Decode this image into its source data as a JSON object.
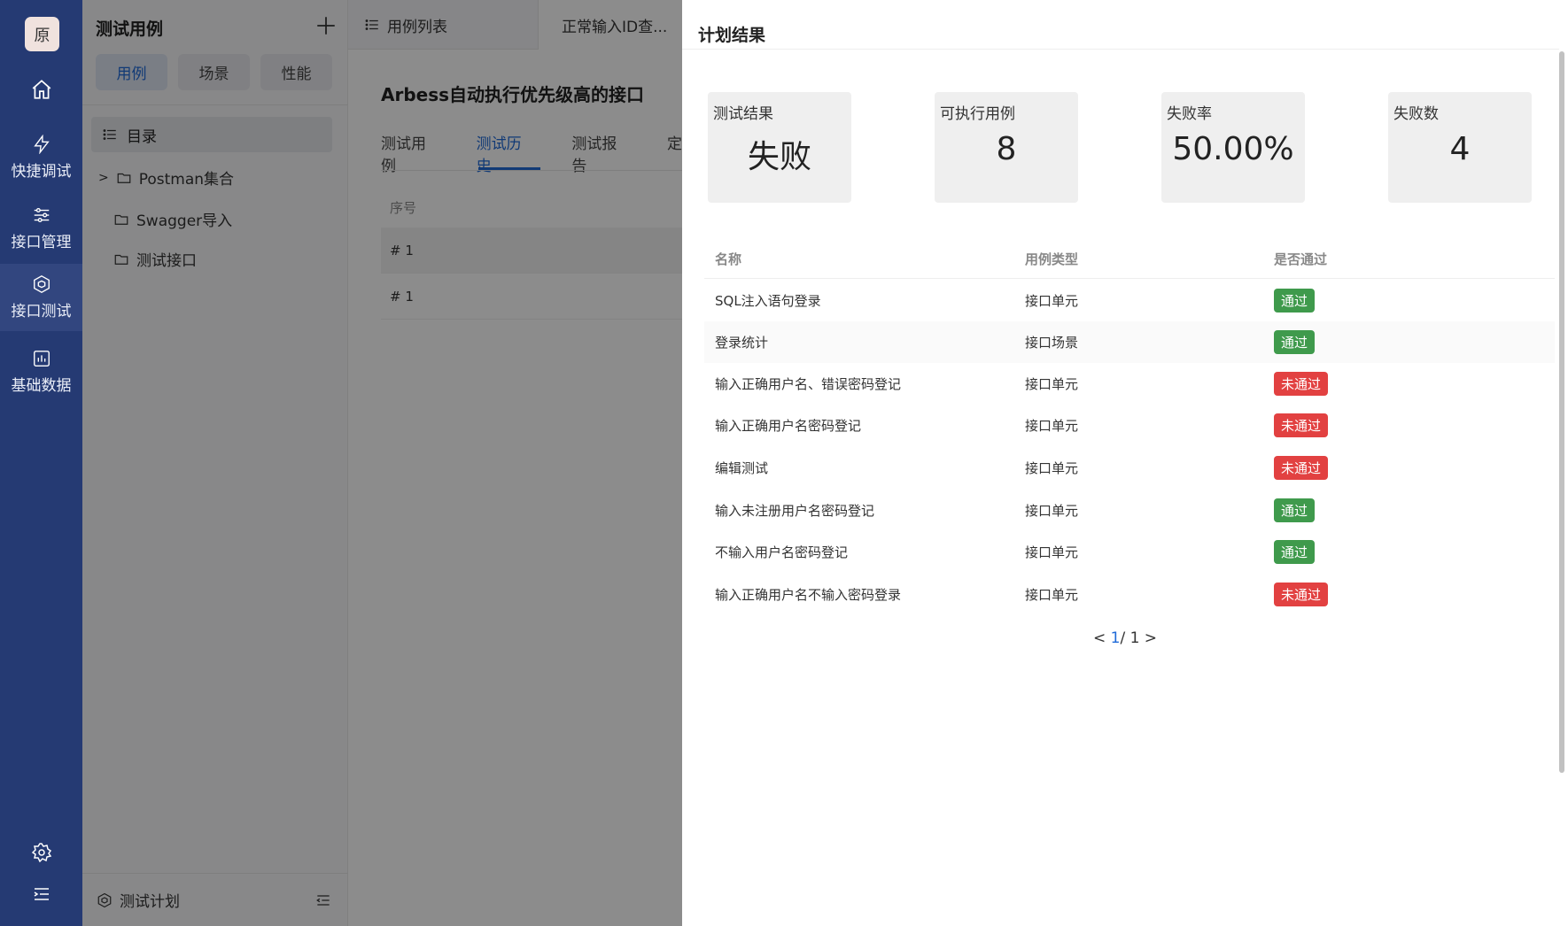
{
  "rail": {
    "logo": "原",
    "items": [
      {
        "label": "快捷调试",
        "icon": "lightning-icon"
      },
      {
        "label": "接口管理",
        "icon": "sliders-icon"
      },
      {
        "label": "接口测试",
        "icon": "cube-icon"
      },
      {
        "label": "基础数据",
        "icon": "chart-box-icon"
      }
    ]
  },
  "panel": {
    "title": "测试用例",
    "segments": [
      "用例",
      "场景",
      "性能"
    ],
    "directory": "目录",
    "tree": [
      "Postman集合",
      "Swagger导入",
      "测试接口"
    ],
    "footer": "测试计划"
  },
  "main": {
    "tabs": [
      "用例列表",
      "正常输入ID查..."
    ],
    "heading": "Arbess自动执行优先级高的接口",
    "subtabs": [
      "测试用例",
      "测试历史",
      "测试报告",
      "定"
    ],
    "column": "序号",
    "rows": [
      "# 1",
      "# 1"
    ]
  },
  "drawer": {
    "title": "计划结果",
    "cards": [
      {
        "title": "测试结果",
        "value": "失败"
      },
      {
        "title": "可执行用例",
        "value": "8"
      },
      {
        "title": "失败率",
        "value": "50.00%"
      },
      {
        "title": "失败数",
        "value": "4"
      }
    ],
    "columns": [
      "名称",
      "用例类型",
      "是否通过"
    ],
    "rows": [
      {
        "name": "SQL注入语句登录",
        "type": "接口单元",
        "status": "通过"
      },
      {
        "name": "登录统计",
        "type": "接口场景",
        "status": "通过"
      },
      {
        "name": "输入正确用户名、错误密码登记",
        "type": "接口单元",
        "status": "未通过"
      },
      {
        "name": "输入正确用户名密码登记",
        "type": "接口单元",
        "status": "未通过"
      },
      {
        "name": "编辑测试",
        "type": "接口单元",
        "status": "未通过"
      },
      {
        "name": "输入未注册用户名密码登记",
        "type": "接口单元",
        "status": "通过"
      },
      {
        "name": "不输入用户名密码登记",
        "type": "接口单元",
        "status": "通过"
      },
      {
        "name": "输入正确用户名不输入密码登录",
        "type": "接口单元",
        "status": "未通过"
      }
    ],
    "pager": {
      "current": "1",
      "total": "/ 1"
    },
    "colors": {
      "pass": "#3f9a4c",
      "fail": "#e24141",
      "accent": "#1f6ad8"
    }
  }
}
